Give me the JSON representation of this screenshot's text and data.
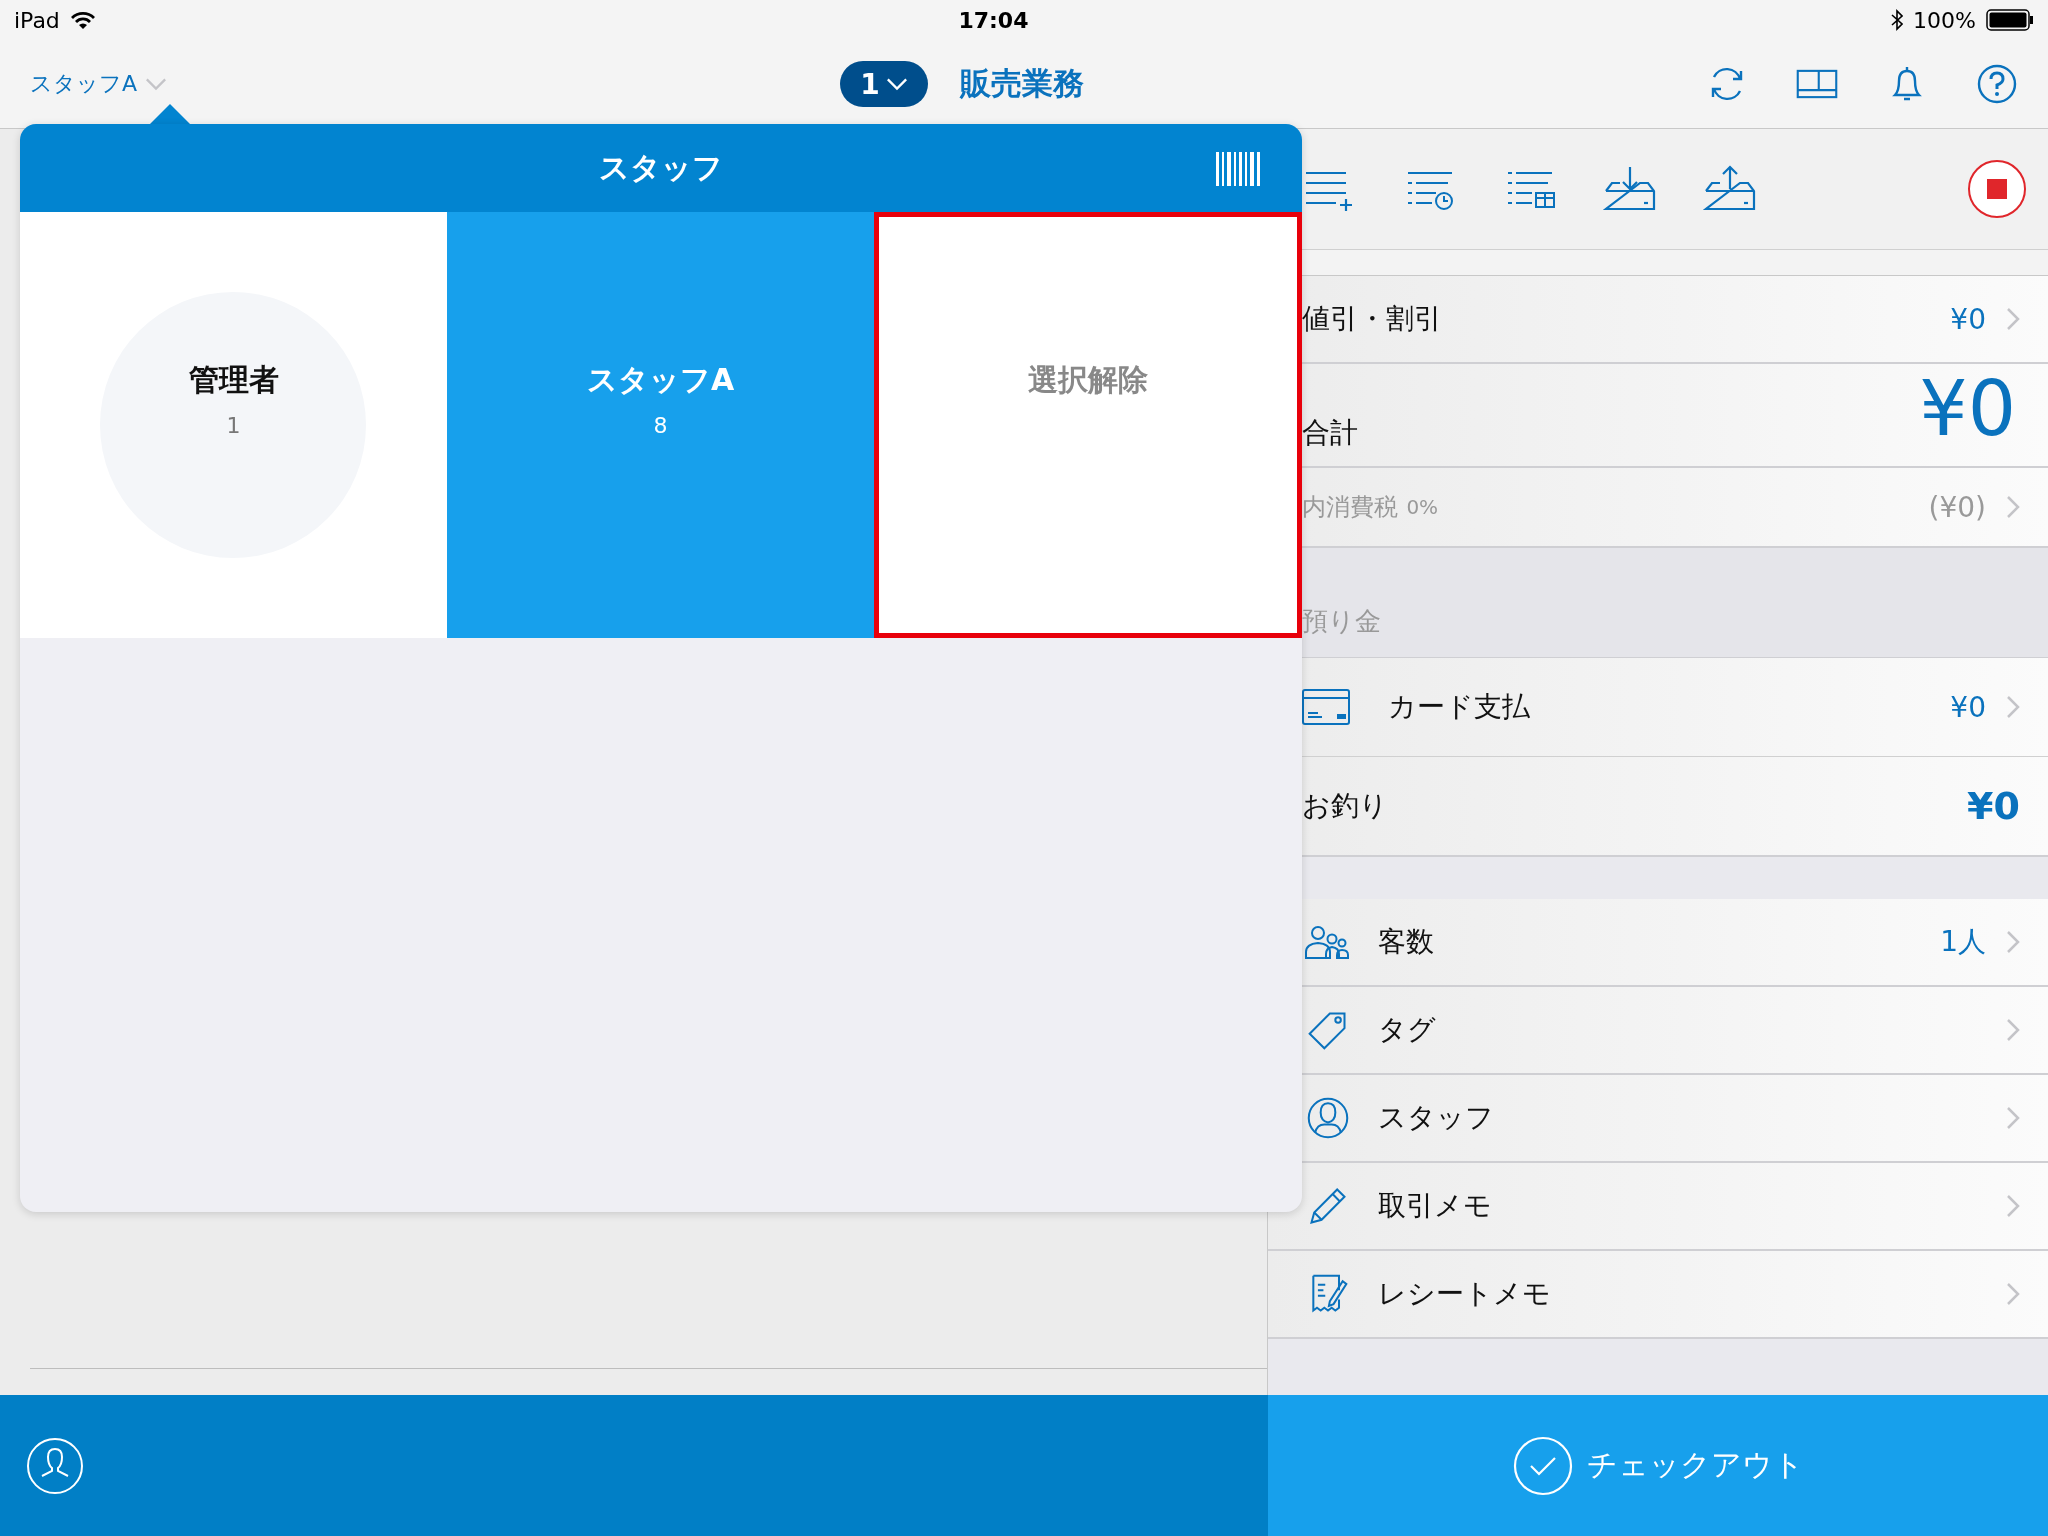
{
  "status_bar": {
    "device": "iPad",
    "time": "17:04",
    "battery": "100%"
  },
  "nav": {
    "staff": "スタッフA",
    "register": "1",
    "title": "販売業務"
  },
  "staff_popup": {
    "title": "スタッフ",
    "staff": [
      {
        "name": "管理者",
        "count": "1",
        "selected": false
      },
      {
        "name": "スタッフA",
        "count": "8",
        "selected": true
      }
    ],
    "clear": {
      "label": "選択解除",
      "highlighted": true
    }
  },
  "summary": [
    {
      "kind": "value",
      "label": "値引・割引",
      "value": "¥0"
    },
    {
      "kind": "total",
      "label": "合計",
      "value": "¥0"
    },
    {
      "kind": "tax",
      "label": "内消費税",
      "rate": "0%",
      "value": "(¥0)"
    },
    {
      "kind": "section",
      "label": "預り金"
    },
    {
      "kind": "payment",
      "label": "カード支払",
      "value": "¥0"
    },
    {
      "kind": "change",
      "label": "お釣り",
      "value": "¥0"
    }
  ],
  "details": [
    {
      "kind": "customers",
      "label": "客数",
      "value": "1人"
    },
    {
      "kind": "tag",
      "label": "タグ"
    },
    {
      "kind": "staff",
      "label": "スタッフ"
    },
    {
      "kind": "memo",
      "label": "取引メモ"
    },
    {
      "kind": "receipt",
      "label": "レシートメモ"
    }
  ],
  "checkout": {
    "label": "チェックアウト"
  }
}
